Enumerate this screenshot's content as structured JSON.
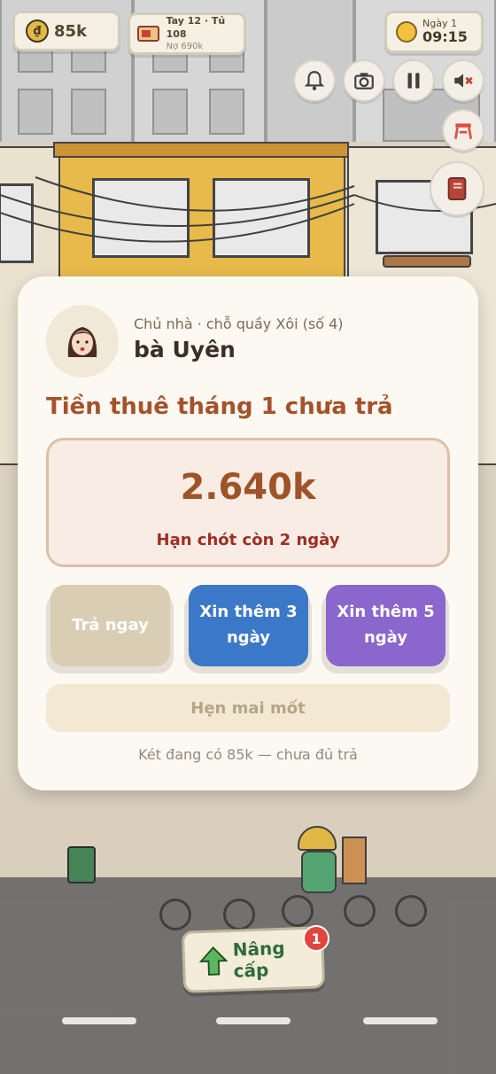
{
  "hud": {
    "coins": "85k",
    "coin_symbol": "₫",
    "ledger_top": "Tay 12 · Tủ 108",
    "ledger_bottom": "Nợ 690k",
    "day": "Ngày 1",
    "time": "09:15"
  },
  "controls": {
    "bell": "bell-icon",
    "camera": "camera-icon",
    "pause": "pause-icon",
    "mute": "speaker-muted-icon",
    "stool": "stool-icon",
    "book": "book-icon"
  },
  "modal": {
    "landlord_subtitle": "Chủ nhà · chỗ quầy Xôi (số 4)",
    "landlord_name": "bà Uyên",
    "title": "Tiền thuê tháng 1 chưa trả",
    "amount": "2.640k",
    "deadline": "Hạn chót còn 2 ngày",
    "options": {
      "pay_now": "Trả ngay",
      "extend_3": "Xin thêm 3 ngày",
      "extend_5": "Xin thêm 5 ngày"
    },
    "postpone": "Hẹn mai mốt",
    "note": "Két đang có 85k — chưa đủ trả",
    "colors": {
      "pay_now": "#d9cdb4",
      "extend_3": "#3b79c8",
      "extend_5": "#8b66cc",
      "title": "#a5522a",
      "deadline": "#9c2f24"
    }
  },
  "upgrade": {
    "label": "Nâng cấp",
    "badge": "1"
  }
}
